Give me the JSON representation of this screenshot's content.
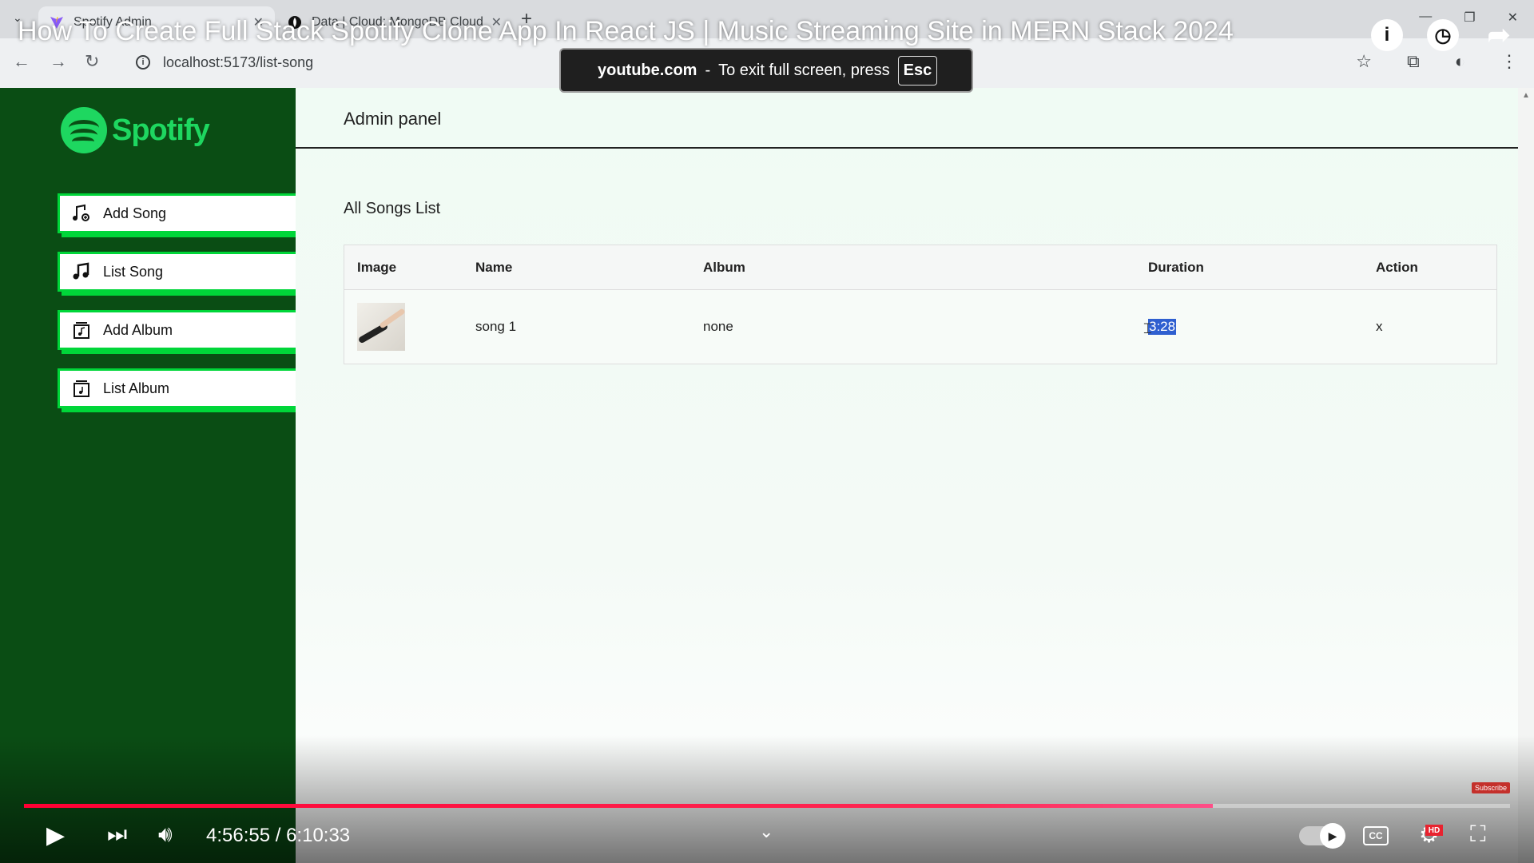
{
  "browser": {
    "tabs": [
      {
        "title": "Spotify Admin",
        "active": true
      },
      {
        "title": "Data | Cloud: MongoDB Cloud",
        "active": false
      }
    ],
    "url": "localhost:5173/list-song"
  },
  "app": {
    "brand": "Spotify",
    "colors": {
      "sidebar": "#0a4d14",
      "accent": "#00d639",
      "logo": "#1ed760"
    },
    "sidebar": {
      "items": [
        {
          "label": "Add Song",
          "icon": "music-add-icon"
        },
        {
          "label": "List Song",
          "icon": "music-note-icon"
        },
        {
          "label": "Add Album",
          "icon": "album-add-icon"
        },
        {
          "label": "List Album",
          "icon": "album-list-icon"
        }
      ]
    },
    "header": {
      "title": "Admin panel"
    },
    "list_title": "All Songs List",
    "table": {
      "columns": [
        "Image",
        "Name",
        "Album",
        "Duration",
        "Action"
      ],
      "rows": [
        {
          "image": "song-thumbnail",
          "name": "song 1",
          "album": "none",
          "duration": "3:28",
          "action": "x"
        }
      ]
    }
  },
  "youtube": {
    "video_title": "How To Create Full Stack Spotify Clone App In React JS | Music Streaming Site in MERN Stack 2024",
    "toast": {
      "site": "youtube.com",
      "message": "To exit full screen, press",
      "key": "Esc"
    },
    "time_display": "4:56:55 / 6:10:33",
    "progress_fraction": 0.8,
    "subscribe_label": "Subscribe"
  }
}
